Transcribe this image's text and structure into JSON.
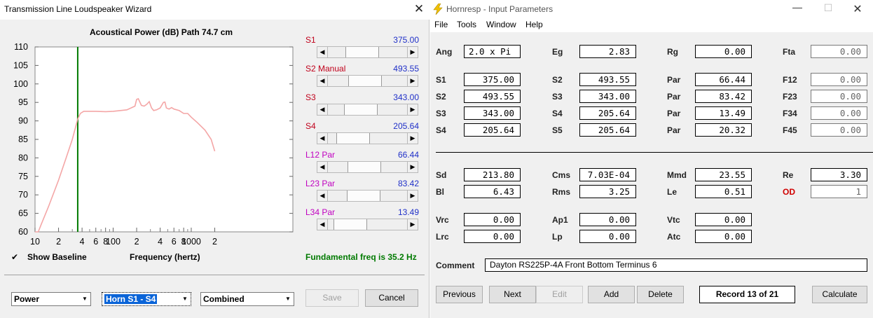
{
  "left": {
    "title": "Transmission Line Loudspeaker Wizard",
    "close_glyph": "✕",
    "chart_title": "Acoustical Power (dB)   Path 74.7 cm",
    "sliders": [
      {
        "label": "S1",
        "mode": "",
        "value": "375.00",
        "position": 0.38
      },
      {
        "label": "S2",
        "mode": "Manual",
        "value": "493.55",
        "position": 0.45
      },
      {
        "label": "S3",
        "mode": "",
        "value": "343.00",
        "position": 0.35
      },
      {
        "label": "S4",
        "mode": "",
        "value": "205.64",
        "position": 0.18
      },
      {
        "label": "L12",
        "mode": "Par",
        "value": "66.44",
        "position": 0.43
      },
      {
        "label": "L23",
        "mode": "Par",
        "value": "83.42",
        "position": 0.42
      },
      {
        "label": "L34",
        "mode": "Par",
        "value": "13.49",
        "position": 0.12
      }
    ],
    "show_baseline_label": "Show Baseline",
    "show_baseline_checked": true,
    "freq_axis_label": "Frequency (hertz)",
    "fundamental": "Fundamental freq is 35.2 Hz",
    "combo_type": "Power",
    "combo_horn": "Horn S1 - S4",
    "combo_mode": "Combined",
    "save_label": "Save",
    "cancel_label": "Cancel"
  },
  "right": {
    "title": "Hornresp - Input Parameters",
    "menu": [
      "File",
      "Tools",
      "Window",
      "Help"
    ],
    "params": {
      "ang": {
        "label": "Ang",
        "value": "2.0 x Pi"
      },
      "eg": {
        "label": "Eg",
        "value": "2.83"
      },
      "rg": {
        "label": "Rg",
        "value": "0.00"
      },
      "fta": {
        "label": "Fta",
        "value": "0.00"
      },
      "s1": {
        "label": "S1",
        "value": "375.00"
      },
      "s2b": {
        "label": "S2",
        "value": "493.55"
      },
      "par1": {
        "label": "Par",
        "value": "66.44"
      },
      "f12": {
        "label": "F12",
        "value": "0.00"
      },
      "s2": {
        "label": "S2",
        "value": "493.55"
      },
      "s3b": {
        "label": "S3",
        "value": "343.00"
      },
      "par2": {
        "label": "Par",
        "value": "83.42"
      },
      "f23": {
        "label": "F23",
        "value": "0.00"
      },
      "s3": {
        "label": "S3",
        "value": "343.00"
      },
      "s4b": {
        "label": "S4",
        "value": "205.64"
      },
      "par3": {
        "label": "Par",
        "value": "13.49"
      },
      "f34": {
        "label": "F34",
        "value": "0.00"
      },
      "s4": {
        "label": "S4",
        "value": "205.64"
      },
      "s5": {
        "label": "S5",
        "value": "205.64"
      },
      "par4": {
        "label": "Par",
        "value": "20.32"
      },
      "f45": {
        "label": "F45",
        "value": "0.00"
      },
      "sd": {
        "label": "Sd",
        "value": "213.80"
      },
      "cms": {
        "label": "Cms",
        "value": "7.03E-04"
      },
      "mmd": {
        "label": "Mmd",
        "value": "23.55"
      },
      "re": {
        "label": "Re",
        "value": "3.30"
      },
      "bl": {
        "label": "Bl",
        "value": "6.43"
      },
      "rms": {
        "label": "Rms",
        "value": "3.25"
      },
      "le": {
        "label": "Le",
        "value": "0.51"
      },
      "od": {
        "label": "OD",
        "value": "1"
      },
      "vrc": {
        "label": "Vrc",
        "value": "0.00"
      },
      "ap1": {
        "label": "Ap1",
        "value": "0.00"
      },
      "vtc": {
        "label": "Vtc",
        "value": "0.00"
      },
      "lrc": {
        "label": "Lrc",
        "value": "0.00"
      },
      "lp": {
        "label": "Lp",
        "value": "0.00"
      },
      "atc": {
        "label": "Atc",
        "value": "0.00"
      }
    },
    "comment_label": "Comment",
    "comment_value": "Dayton RS225P-4A Front Bottom Terminus 6",
    "buttons": {
      "previous": "Previous",
      "next": "Next",
      "edit": "Edit",
      "add": "Add",
      "delete": "Delete",
      "record": "Record 13 of 21",
      "calculate": "Calculate"
    }
  },
  "chart_data": {
    "type": "line",
    "title": "Acoustical Power (dB)   Path 74.7 cm",
    "xlabel": "Frequency (hertz)",
    "ylabel": "",
    "x_scale": "log",
    "xlim": [
      10,
      20000
    ],
    "ylim": [
      60,
      110
    ],
    "y_ticks": [
      110,
      105,
      100,
      95,
      90,
      85,
      80,
      75,
      70,
      65,
      60
    ],
    "x_tick_labels": [
      {
        "x": 10,
        "label": "10"
      },
      {
        "x": 20,
        "label": "2"
      },
      {
        "x": 40,
        "label": "4"
      },
      {
        "x": 60,
        "label": "6"
      },
      {
        "x": 80,
        "label": "8"
      },
      {
        "x": 100,
        "label": "100"
      },
      {
        "x": 200,
        "label": "2"
      },
      {
        "x": 400,
        "label": "4"
      },
      {
        "x": 600,
        "label": "6"
      },
      {
        "x": 800,
        "label": "8"
      },
      {
        "x": 1000,
        "label": "1000"
      },
      {
        "x": 2000,
        "label": "2"
      }
    ],
    "x_minor_ticks": [
      30,
      50,
      70,
      90,
      300,
      500,
      700,
      900
    ],
    "marker_x": 35.2,
    "marker_color": "#007a00",
    "grid": false,
    "series": [
      {
        "color": "#f4a6a6",
        "x": [
          10,
          11,
          12,
          15,
          20,
          25,
          30,
          35.2,
          38,
          42,
          50,
          60,
          80,
          100,
          150,
          190,
          200,
          210,
          230,
          250,
          270,
          290,
          310,
          330,
          360,
          400,
          440,
          460,
          480,
          520,
          560,
          600,
          700,
          800,
          900,
          1000,
          1200,
          1500,
          1800,
          2000
        ],
        "y": [
          58,
          60,
          62,
          67,
          74,
          80,
          85,
          90.5,
          92,
          92.6,
          92.6,
          92.6,
          92.5,
          92.6,
          93,
          94,
          95.8,
          96,
          94.2,
          94,
          94.5,
          95.2,
          93.5,
          92.8,
          93,
          93.5,
          95,
          95.1,
          93.5,
          93.2,
          93.6,
          93.2,
          92.8,
          92,
          92,
          91,
          89.5,
          87.5,
          85,
          81.8
        ]
      }
    ]
  },
  "colors": {
    "curve": "#f4a6a6",
    "marker": "#007a00",
    "fundamental_text": "#007a00",
    "label_red": "#c0001b",
    "label_magenta": "#c000c0",
    "value_blue": "#2030c8",
    "od_red": "#d00000",
    "selection_blue": "#0a64d8",
    "bolt_yellow": "#f2c200"
  }
}
